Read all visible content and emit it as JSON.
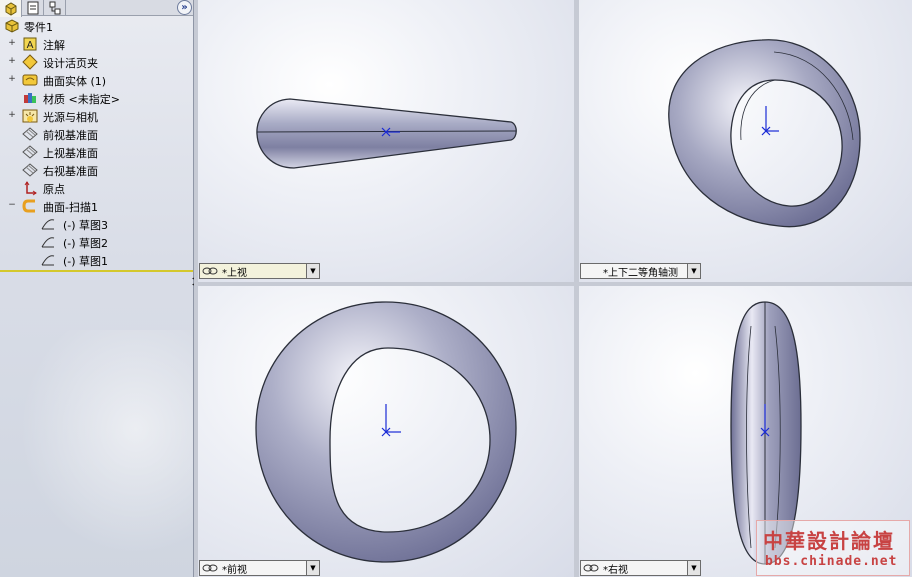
{
  "sidebar": {
    "tabs": [
      {
        "icon": "feature-manager-icon"
      },
      {
        "icon": "property-manager-icon"
      },
      {
        "icon": "configuration-manager-icon"
      }
    ],
    "collapse_label": "»",
    "tree": {
      "root": {
        "label": "零件1",
        "icon": "part-icon"
      },
      "items": [
        {
          "label": "注解",
          "icon": "annotation-icon",
          "expander": "+"
        },
        {
          "label": "设计活页夹",
          "icon": "design-binder-icon",
          "expander": "+"
        },
        {
          "label": "曲面实体 (1)",
          "icon": "surface-body-icon",
          "expander": "+"
        },
        {
          "label": "材质 <未指定>",
          "icon": "material-icon",
          "expander": ""
        },
        {
          "label": "光源与相机",
          "icon": "lights-camera-icon",
          "expander": "+"
        },
        {
          "label": "前视基准面",
          "icon": "plane-icon",
          "expander": ""
        },
        {
          "label": "上视基准面",
          "icon": "plane-icon",
          "expander": ""
        },
        {
          "label": "右视基准面",
          "icon": "plane-icon",
          "expander": ""
        },
        {
          "label": "原点",
          "icon": "origin-icon",
          "expander": ""
        },
        {
          "label": "曲面-扫描1",
          "icon": "surface-sweep-icon",
          "expander": "−"
        }
      ],
      "children": [
        {
          "label": "(-)  草图3",
          "icon": "sketch-icon"
        },
        {
          "label": "(-)  草图2",
          "icon": "sketch-icon"
        },
        {
          "label": "(-)  草图1",
          "icon": "sketch-icon"
        }
      ]
    }
  },
  "viewports": {
    "top": {
      "label": "*上视"
    },
    "iso": {
      "label": "*上下二等角轴测"
    },
    "front": {
      "label": "*前视"
    },
    "right": {
      "label": "*右视"
    }
  },
  "watermark": {
    "title": "中華設計論壇",
    "url": "bbs.chinade.net"
  },
  "colors": {
    "accent_divider": "#d4c82c",
    "model_stroke": "#2b2f3a",
    "axis": "#1a2bd6",
    "watermark": "#c84343"
  }
}
